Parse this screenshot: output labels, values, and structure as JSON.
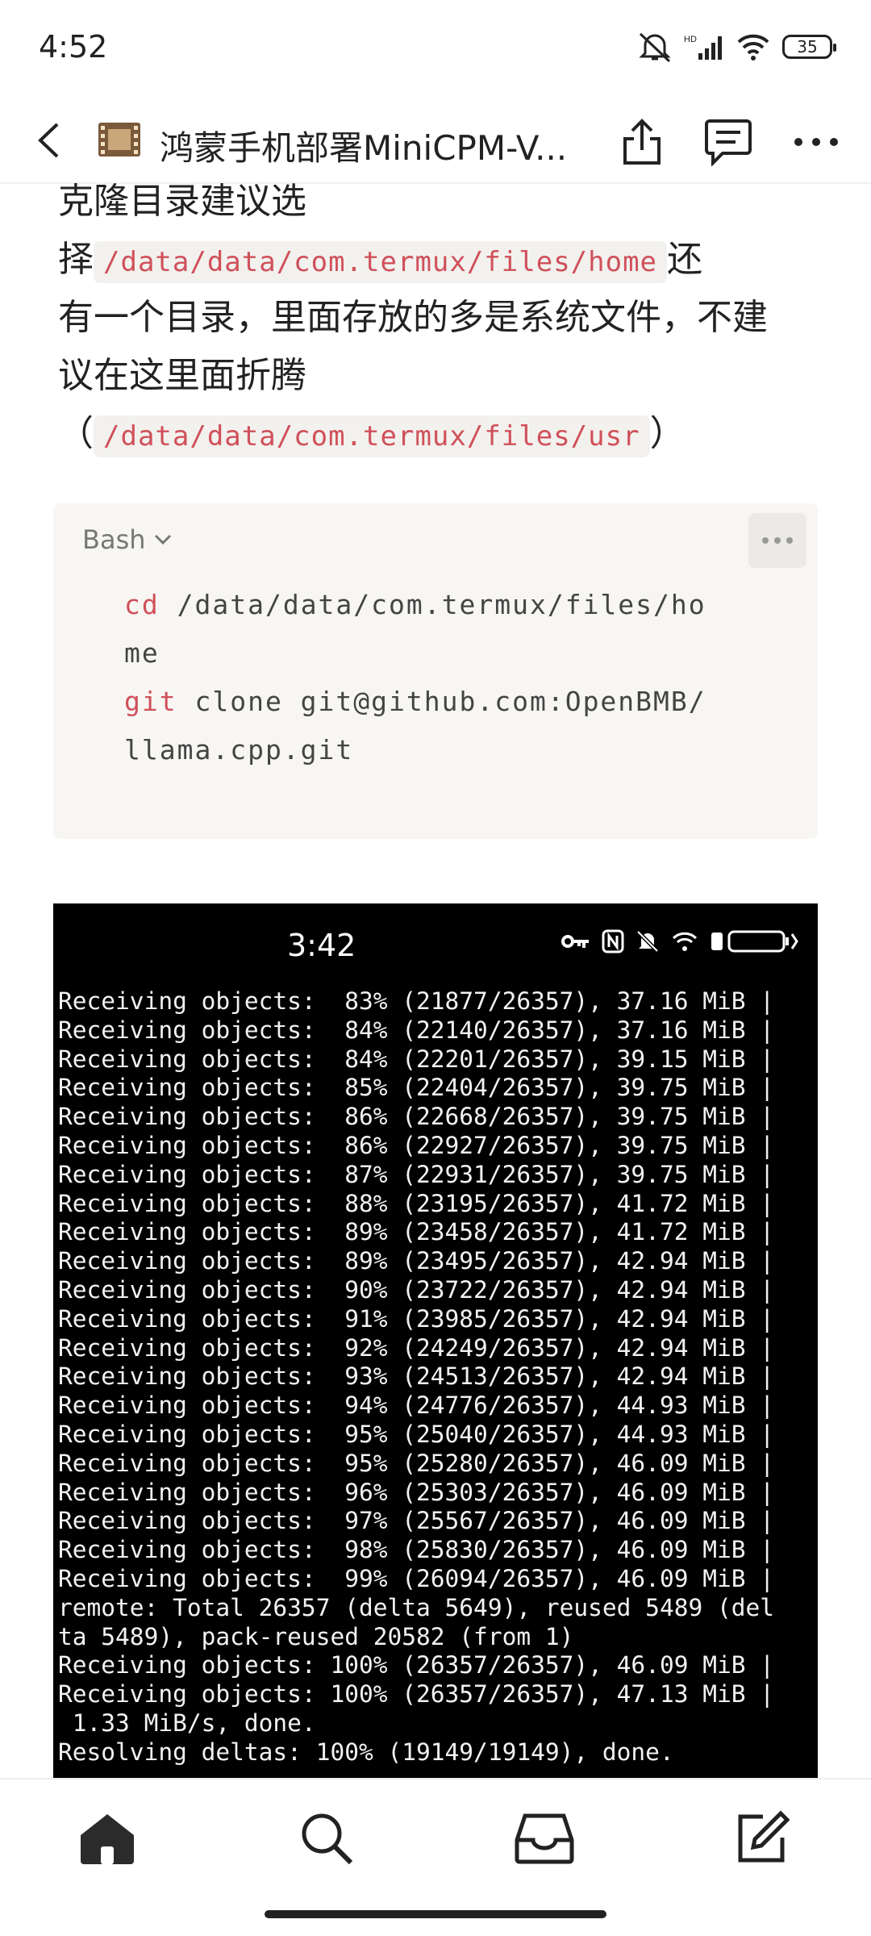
{
  "status_bar": {
    "time": "4:52",
    "battery": "35",
    "icons": [
      "mute-icon",
      "signal-icon",
      "wifi-icon",
      "battery-icon"
    ]
  },
  "header": {
    "title": "鸿蒙手机部署MiniCPM-V...",
    "icons": [
      "back-icon",
      "film-icon",
      "share-icon",
      "comment-icon",
      "more-icon"
    ]
  },
  "paragraph": {
    "line1": "克隆目录建议选",
    "line2_prefix": "择",
    "code1": "/data/data/com.termux/files/home",
    "line2_suffix": "还",
    "line3": "有一个目录，里面存放的多是系统文件，不建",
    "line4": "议在这里面折腾",
    "paren_open": "（",
    "code2": "/data/data/com.termux/files/usr",
    "paren_close": "）"
  },
  "code_block": {
    "language": "Bash",
    "lines": [
      {
        "kw": "cd",
        "rest": " /data/data/com.termux/files/ho"
      },
      {
        "kw": "",
        "rest": "me"
      },
      {
        "kw": "git",
        "rest": " clone git@github.com:OpenBMB/"
      },
      {
        "kw": "",
        "rest": "llama.cpp.git"
      }
    ]
  },
  "terminal": {
    "time": "3:42",
    "lines": [
      "Receiving objects:  83% (21877/26357), 37.16 MiB |",
      "Receiving objects:  84% (22140/26357), 37.16 MiB |",
      "Receiving objects:  84% (22201/26357), 39.15 MiB |",
      "Receiving objects:  85% (22404/26357), 39.75 MiB |",
      "Receiving objects:  86% (22668/26357), 39.75 MiB |",
      "Receiving objects:  86% (22927/26357), 39.75 MiB |",
      "Receiving objects:  87% (22931/26357), 39.75 MiB |",
      "Receiving objects:  88% (23195/26357), 41.72 MiB |",
      "Receiving objects:  89% (23458/26357), 41.72 MiB |",
      "Receiving objects:  89% (23495/26357), 42.94 MiB |",
      "Receiving objects:  90% (23722/26357), 42.94 MiB |",
      "Receiving objects:  91% (23985/26357), 42.94 MiB |",
      "Receiving objects:  92% (24249/26357), 42.94 MiB |",
      "Receiving objects:  93% (24513/26357), 42.94 MiB |",
      "Receiving objects:  94% (24776/26357), 44.93 MiB |",
      "Receiving objects:  95% (25040/26357), 44.93 MiB |",
      "Receiving objects:  95% (25280/26357), 46.09 MiB |",
      "Receiving objects:  96% (25303/26357), 46.09 MiB |",
      "Receiving objects:  97% (25567/26357), 46.09 MiB |",
      "Receiving objects:  98% (25830/26357), 46.09 MiB |",
      "Receiving objects:  99% (26094/26357), 46.09 MiB |",
      "remote: Total 26357 (delta 5649), reused 5489 (del",
      "ta 5489), pack-reused 20582 (from 1)",
      "Receiving objects: 100% (26357/26357), 46.09 MiB |",
      "Receiving objects: 100% (26357/26357), 47.13 MiB |",
      " 1.33 MiB/s, done.",
      "Resolving deltas: 100% (19149/19149), done."
    ]
  },
  "bottom_nav": {
    "items": [
      "home-icon",
      "search-icon",
      "inbox-icon",
      "compose-icon"
    ]
  },
  "colors": {
    "inline_code_text": "#d0505a",
    "inline_code_bg": "#f2f1ee",
    "code_block_bg": "#f7f6f3",
    "terminal_bg": "#000000"
  }
}
